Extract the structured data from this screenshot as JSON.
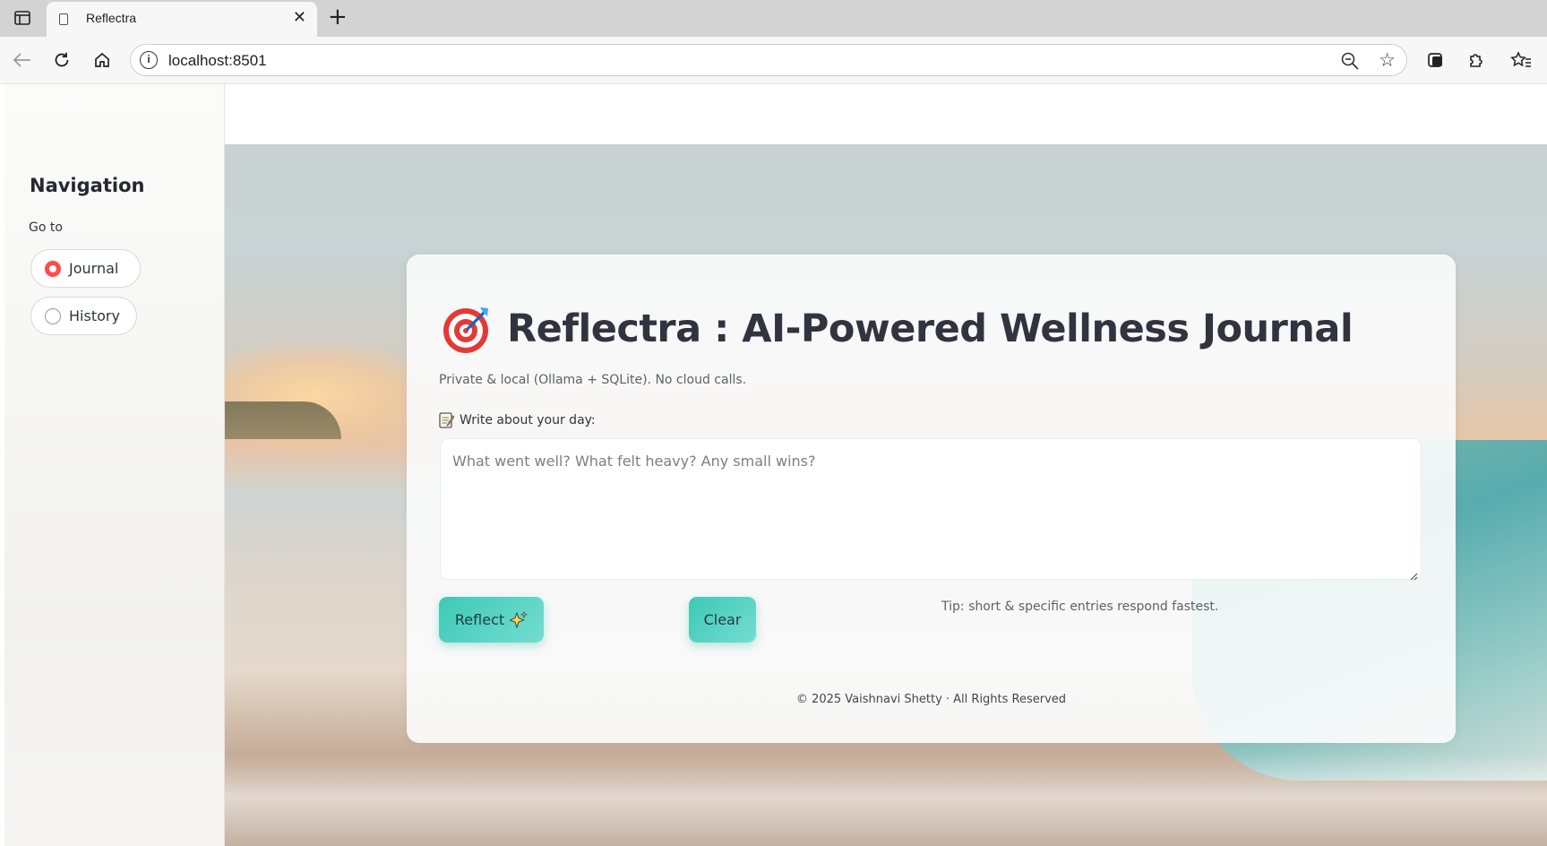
{
  "browser": {
    "tab_title": "Reflectra",
    "url": "localhost:8501",
    "icons": [
      "tab-sidebar-icon",
      "page-icon",
      "close-icon",
      "plus-icon",
      "back-arrow-icon",
      "reload-icon",
      "home-icon",
      "info-icon",
      "zoom-out-icon",
      "star-icon",
      "collections-icon",
      "extensions-icon",
      "favorites-icon"
    ]
  },
  "sidebar": {
    "title": "Navigation",
    "group_label": "Go to",
    "options": [
      {
        "label": "Journal",
        "selected": true
      },
      {
        "label": "History",
        "selected": false
      }
    ],
    "accent": "#ff4b4b"
  },
  "main": {
    "title": "Reflectra : AI-Powered Wellness Journal",
    "title_icon": "direct-hit-target-icon",
    "subtitle": "Private & local (Ollama + SQLite). No cloud calls.",
    "field_label": "Write about your day:",
    "field_icon": "memo-icon",
    "textarea_value": "",
    "textarea_placeholder": "What went well? What felt heavy? Any small wins?",
    "reflect_label": "Reflect",
    "reflect_icon": "sparkles-icon",
    "clear_label": "Clear",
    "tip": "Tip: short & specific entries respond fastest.",
    "footer": "© 2025 Vaishnavi Shetty · All Rights Reserved",
    "button_color": "#3ec9b6"
  }
}
